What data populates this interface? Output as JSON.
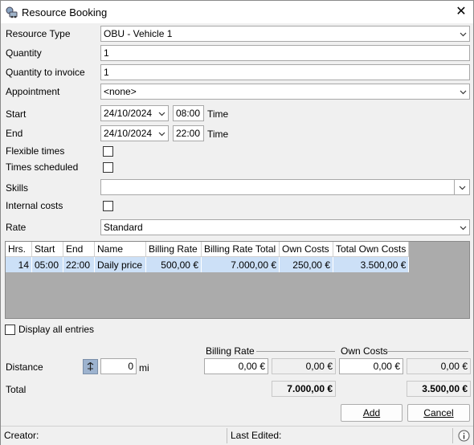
{
  "window": {
    "title": "Resource Booking",
    "close": "✕"
  },
  "form": {
    "resource_type": {
      "label": "Resource Type",
      "value": "OBU - Vehicle 1"
    },
    "quantity": {
      "label": "Quantity",
      "value": "1"
    },
    "quantity_to_invoice": {
      "label": "Quantity to invoice",
      "value": "1"
    },
    "appointment": {
      "label": "Appointment",
      "value": "<none>"
    },
    "start": {
      "label": "Start",
      "date": "24/10/2024",
      "time": "08:00",
      "time_label": "Time"
    },
    "end": {
      "label": "End",
      "date": "24/10/2024",
      "time": "22:00",
      "time_label": "Time"
    },
    "flexible_times": {
      "label": "Flexible times",
      "checked": false
    },
    "times_scheduled": {
      "label": "Times scheduled",
      "checked": false
    },
    "skills": {
      "label": "Skills",
      "value": ""
    },
    "internal_costs": {
      "label": "Internal costs",
      "checked": false
    },
    "rate": {
      "label": "Rate",
      "value": "Standard"
    }
  },
  "grid": {
    "columns": [
      "Hrs.",
      "Start",
      "End",
      "Name",
      "Billing Rate",
      "Billing Rate Total",
      "Own Costs",
      "Total Own Costs"
    ],
    "rows": [
      [
        "14",
        "05:00",
        "22:00",
        "Daily price",
        "500,00 €",
        "7.000,00 €",
        "250,00 €",
        "3.500,00 €"
      ]
    ]
  },
  "display_all_entries": {
    "label": "Display all entries",
    "checked": false
  },
  "summary": {
    "billing_rate_header": "Billing Rate",
    "own_costs_header": "Own Costs",
    "distance": {
      "label": "Distance",
      "value": "0",
      "unit": "mi"
    },
    "distance_billing_input": "0,00 €",
    "distance_billing_total": "0,00 €",
    "distance_own_input": "0,00 €",
    "distance_own_total": "0,00 €",
    "total_label": "Total",
    "total_billing": "7.000,00 €",
    "total_own": "3.500,00 €"
  },
  "buttons": {
    "add": "Add",
    "cancel": "Cancel"
  },
  "status": {
    "creator": "Creator:",
    "last_edited": "Last Edited:"
  }
}
